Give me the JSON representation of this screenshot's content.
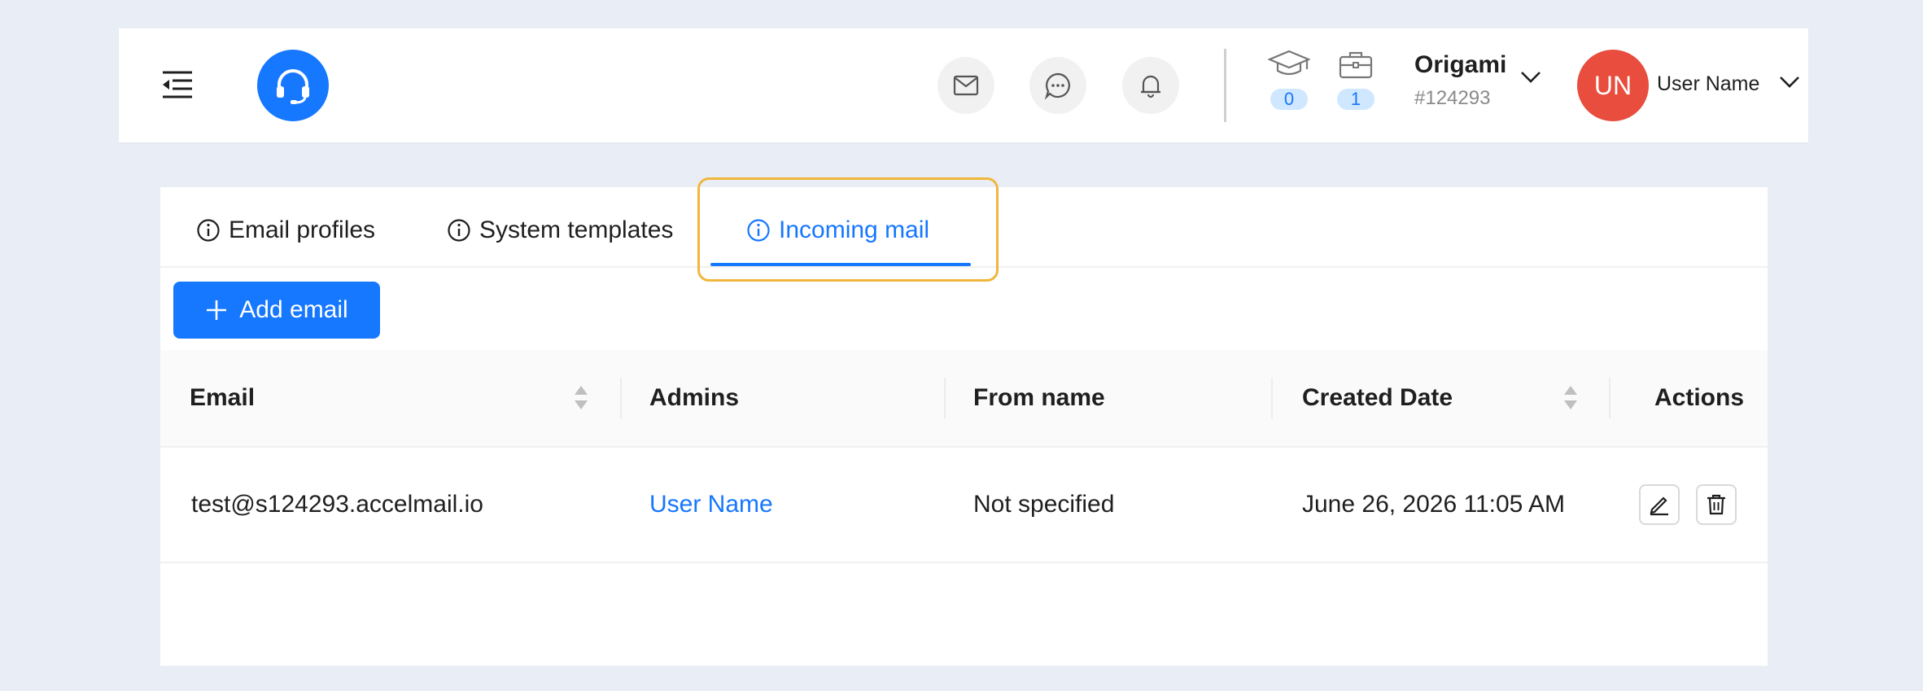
{
  "header": {
    "counters": [
      {
        "icon": "graduation-cap-icon",
        "value": "0"
      },
      {
        "icon": "briefcase-icon",
        "value": "1"
      }
    ],
    "organization": {
      "name": "Origami",
      "id": "#124293"
    },
    "user": {
      "initials": "UN",
      "name": "User Name"
    }
  },
  "tabs": [
    {
      "label": "Email profiles",
      "active": false
    },
    {
      "label": "System templates",
      "active": false
    },
    {
      "label": "Incoming mail",
      "active": true
    }
  ],
  "toolbar": {
    "add_label": "Add email"
  },
  "table": {
    "columns": [
      "Email",
      "Admins",
      "From name",
      "Created Date",
      "Actions"
    ],
    "rows": [
      {
        "email": "test@s124293.accelmail.io",
        "admins": "User Name",
        "from_name": "Not specified",
        "created": "June 26, 2026 11:05 AM"
      }
    ]
  },
  "colors": {
    "accent": "#1677ff",
    "avatar": "#e84d3d",
    "highlight": "#f0b73c"
  }
}
